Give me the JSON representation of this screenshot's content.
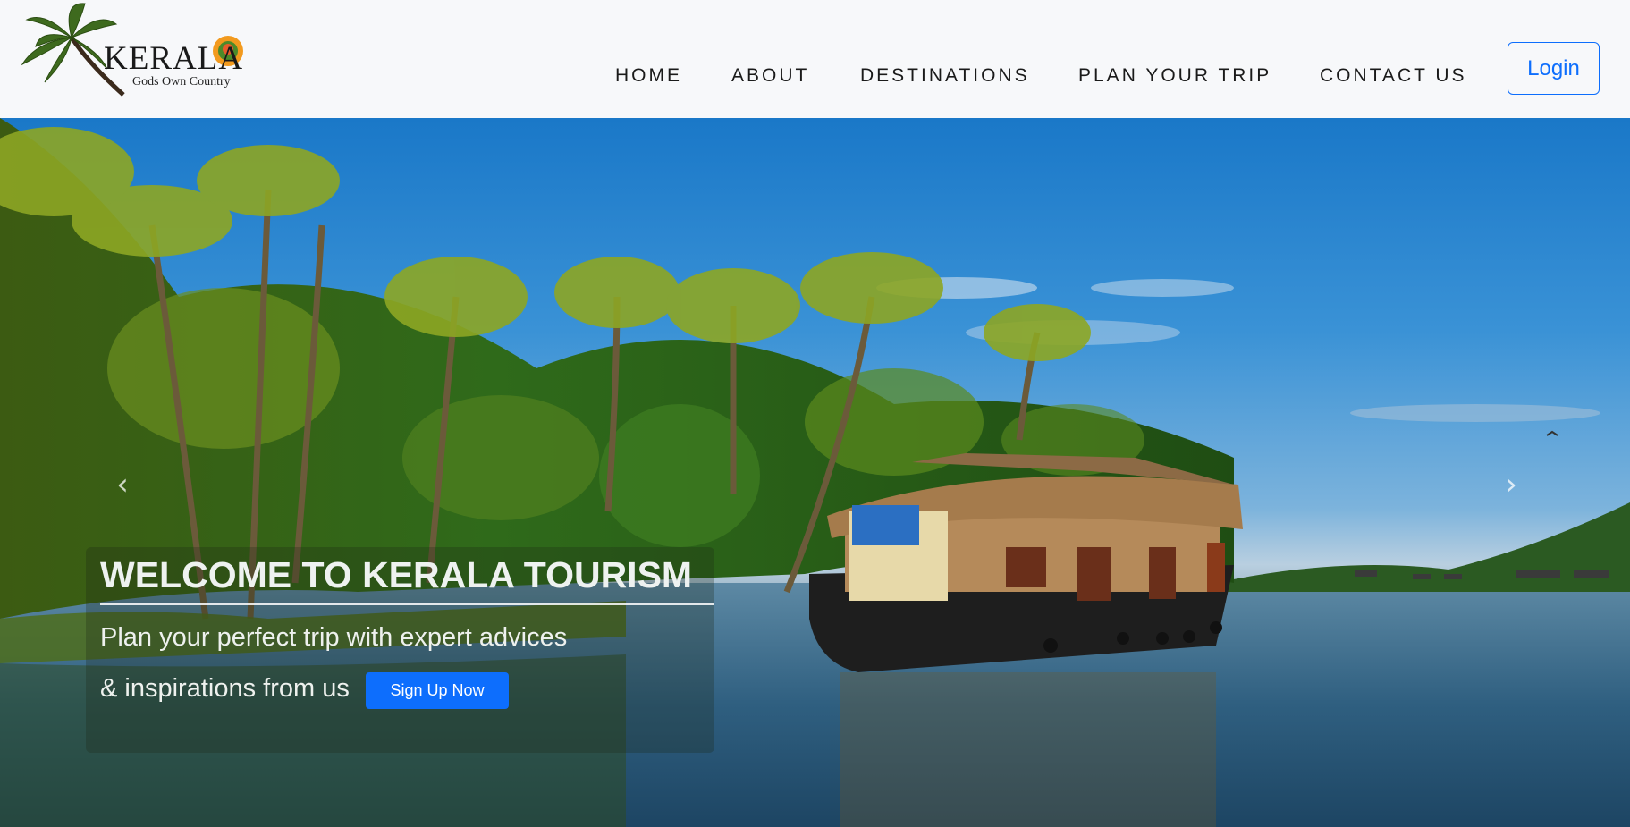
{
  "brand": {
    "title": "KERALA",
    "subtitle": "Gods Own Country"
  },
  "nav": {
    "items": [
      {
        "label": "HOME"
      },
      {
        "label": "ABOUT"
      },
      {
        "label": "DESTINATIONS"
      },
      {
        "label": "PLAN YOUR TRIP"
      },
      {
        "label": "CONTACT US"
      }
    ],
    "login_label": "Login"
  },
  "hero": {
    "prev_icon": "‹",
    "next_icon": "›",
    "caption": {
      "title": "WELCOME TO KERALA TOURISM",
      "line1": "Plan your perfect trip with expert advices",
      "line2": "& inspirations from us",
      "cta_label": "Sign Up Now"
    }
  },
  "colors": {
    "accent": "#0d6efd",
    "navbar_bg": "#f7f8fa",
    "nav_text": "#1a1a1a"
  }
}
